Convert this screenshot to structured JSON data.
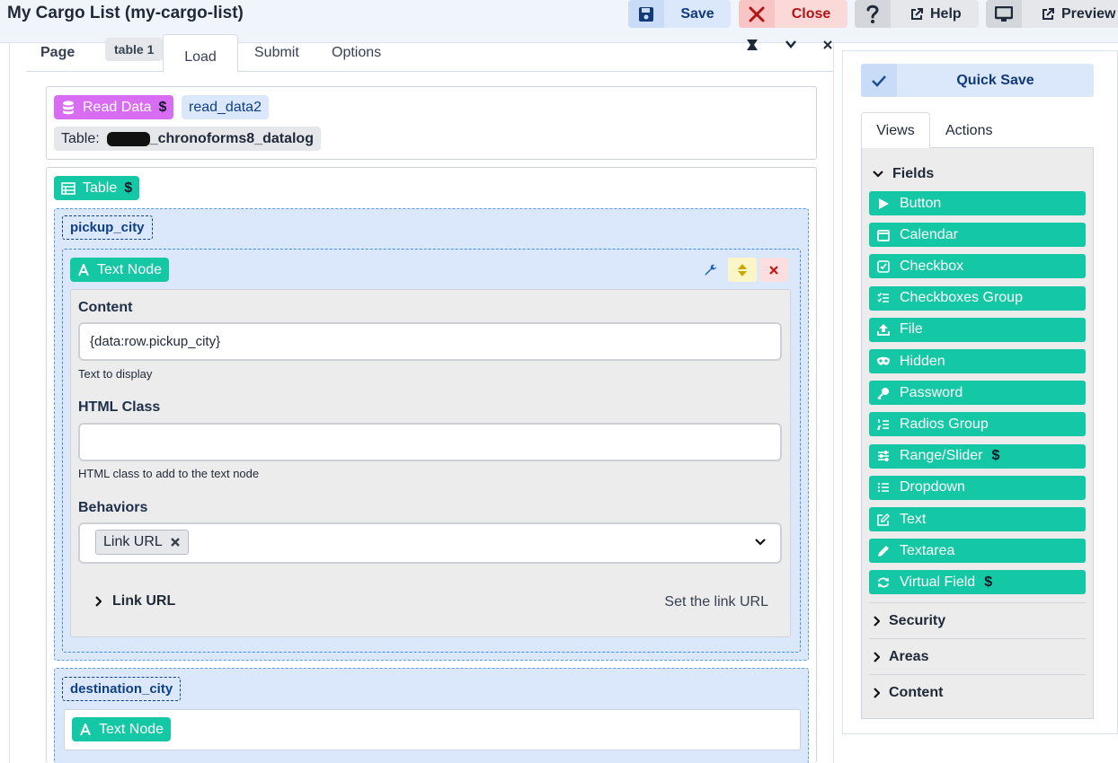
{
  "header": {
    "title": "My Cargo List (my-cargo-list)",
    "save_label": "Save",
    "close_label": "Close",
    "help_label": "Help",
    "preview_label": "Preview"
  },
  "tabs": {
    "page": "Page",
    "table_pill": "table 1",
    "load": "Load",
    "submit": "Submit",
    "options": "Options"
  },
  "read_data": {
    "tag_label": "Read Data",
    "name": "read_data2",
    "table_prefix": "Table:",
    "table_name": "_chronoforms8_datalog"
  },
  "table_block": {
    "tag_label": "Table"
  },
  "pickup": {
    "field": "pickup_city",
    "node_label": "Text Node",
    "content_label": "Content",
    "content_value": "{data:row.pickup_city}",
    "content_help": "Text to display",
    "class_label": "HTML Class",
    "class_value": "",
    "class_help": "HTML class to add to the text node",
    "behaviors_label": "Behaviors",
    "behavior_chip": "Link URL",
    "link_section": "Link URL",
    "link_help": "Set the link URL"
  },
  "destination": {
    "field": "destination_city",
    "node_label": "Text Node"
  },
  "sidebar": {
    "quick_save": "Quick Save",
    "tab_views": "Views",
    "tab_actions": "Actions",
    "fields_heading": "Fields",
    "fields": [
      {
        "label": "Button",
        "icon": "play-icon",
        "paid": false
      },
      {
        "label": "Calendar",
        "icon": "calendar-icon",
        "paid": false
      },
      {
        "label": "Checkbox",
        "icon": "checkbox-icon",
        "paid": false
      },
      {
        "label": "Checkboxes Group",
        "icon": "checklist-icon",
        "paid": false
      },
      {
        "label": "File",
        "icon": "upload-icon",
        "paid": false
      },
      {
        "label": "Hidden",
        "icon": "mask-icon",
        "paid": false
      },
      {
        "label": "Password",
        "icon": "key-icon",
        "paid": false
      },
      {
        "label": "Radios Group",
        "icon": "numbered-list-icon",
        "paid": false
      },
      {
        "label": "Range/Slider",
        "icon": "sliders-icon",
        "paid": true
      },
      {
        "label": "Dropdown",
        "icon": "list-icon",
        "paid": false
      },
      {
        "label": "Text",
        "icon": "edit-icon",
        "paid": false
      },
      {
        "label": "Textarea",
        "icon": "pencil-icon",
        "paid": false
      },
      {
        "label": "Virtual Field",
        "icon": "refresh-icon",
        "paid": true
      }
    ],
    "sections": [
      "Security",
      "Areas",
      "Content"
    ]
  },
  "colors": {
    "accent_green": "#14c8a5",
    "accent_purple": "#d86cf2",
    "primary_blue": "#0f3f85",
    "danger_red": "#b31313"
  }
}
